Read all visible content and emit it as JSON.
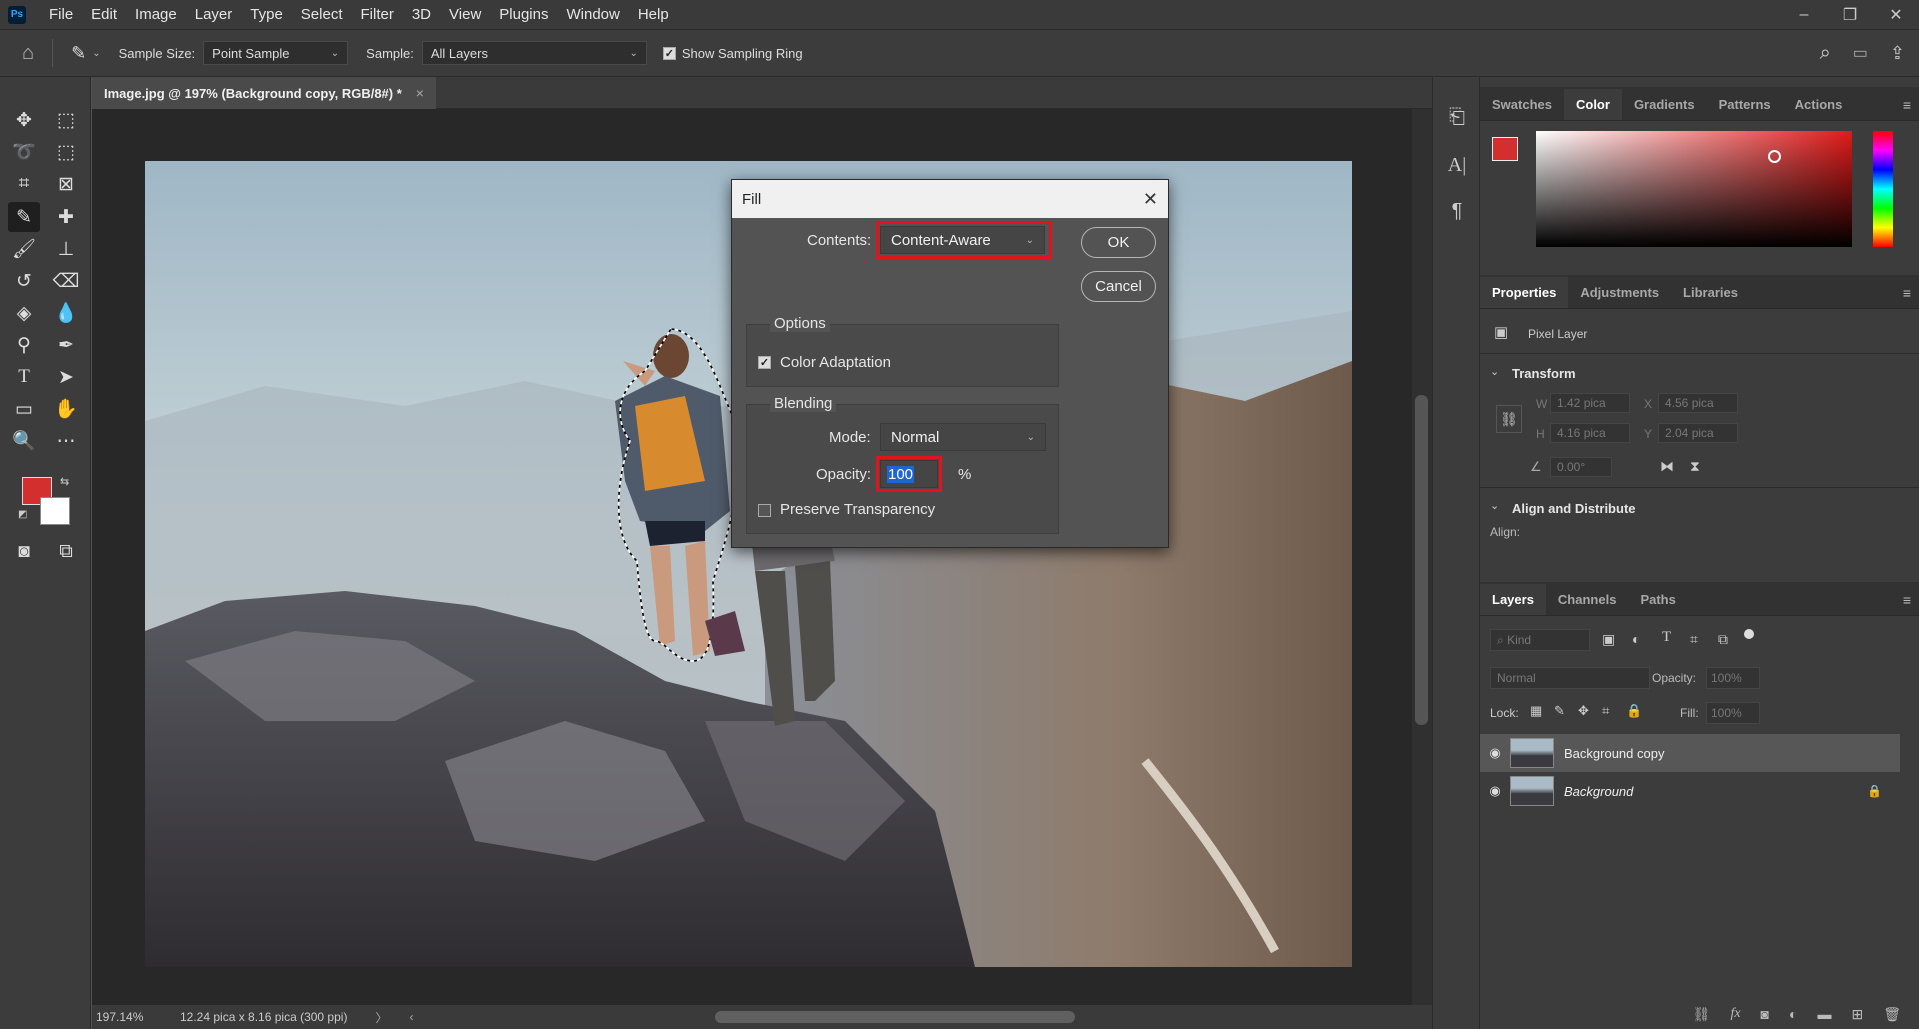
{
  "app": {
    "logo": "Ps",
    "menu": [
      "File",
      "Edit",
      "Image",
      "Layer",
      "Type",
      "Select",
      "Filter",
      "3D",
      "View",
      "Plugins",
      "Window",
      "Help"
    ]
  },
  "options_bar": {
    "sample_size_label": "Sample Size:",
    "sample_size_value": "Point Sample",
    "sample_label": "Sample:",
    "sample_value": "All Layers",
    "show_ring_label": "Show Sampling Ring",
    "show_ring_checked": true
  },
  "document": {
    "tab_title": "Image.jpg @ 197% (Background copy, RGB/8#) *",
    "close_glyph": "×",
    "zoom": "197.14%",
    "doc_size": "12.24 pica x 8.16 pica (300 ppi)"
  },
  "colors": {
    "foreground": "#d32f2f",
    "background": "#ffffff",
    "highlight": "#e0141e"
  },
  "color_panel": {
    "tabs": [
      "Swatches",
      "Color",
      "Gradients",
      "Patterns",
      "Actions"
    ],
    "active_tab": "Color"
  },
  "properties_panel": {
    "tabs": [
      "Properties",
      "Adjustments",
      "Libraries"
    ],
    "active_tab": "Properties",
    "layer_type": "Pixel Layer",
    "transform_label": "Transform",
    "w_label": "W",
    "w_value": "1.42 pica",
    "h_label": "H",
    "h_value": "4.16 pica",
    "x_label": "X",
    "x_value": "4.56 pica",
    "y_label": "Y",
    "y_value": "2.04 pica",
    "angle_value": "0.00°",
    "align_label": "Align and Distribute",
    "align_sub": "Align:"
  },
  "layers_panel": {
    "tabs": [
      "Layers",
      "Channels",
      "Paths"
    ],
    "active_tab": "Layers",
    "kind_placeholder": "Kind",
    "blend_mode": "Normal",
    "opacity_label": "Opacity:",
    "opacity_value": "100%",
    "lock_label": "Lock:",
    "fill_label": "Fill:",
    "fill_value": "100%",
    "layers": [
      {
        "name": "Background copy",
        "selected": true,
        "locked": false
      },
      {
        "name": "Background",
        "selected": false,
        "locked": true
      }
    ]
  },
  "fill_dialog": {
    "title": "Fill",
    "contents_label": "Contents:",
    "contents_value": "Content-Aware",
    "ok_label": "OK",
    "cancel_label": "Cancel",
    "options_label": "Options",
    "color_adaptation_label": "Color Adaptation",
    "color_adaptation_checked": true,
    "blending_label": "Blending",
    "mode_label": "Mode:",
    "mode_value": "Normal",
    "opacity_label": "Opacity:",
    "opacity_value": "100",
    "percent": "%",
    "preserve_label": "Preserve Transparency",
    "preserve_checked": false
  }
}
